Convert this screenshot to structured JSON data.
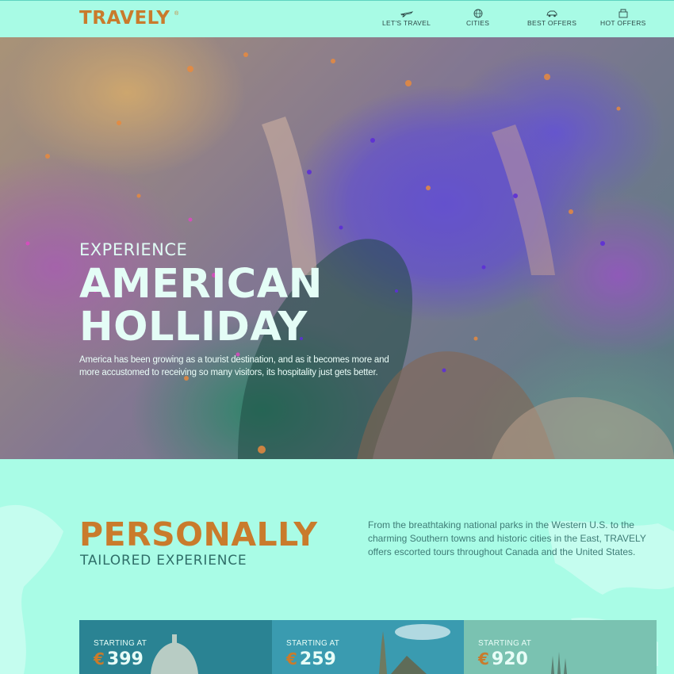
{
  "header": {
    "logo": "TRAVELY",
    "logo_mark": "®",
    "nav": [
      {
        "label": "LET'S TRAVEL",
        "icon": "plane-icon"
      },
      {
        "label": "CITIES",
        "icon": "globe-icon"
      },
      {
        "label": "BEST OFFERS",
        "icon": "car-icon"
      },
      {
        "label": "HOT OFFERS",
        "icon": "gift-icon"
      }
    ]
  },
  "hero": {
    "eyebrow": "EXPERIENCE",
    "title_line1": "AMERICAN",
    "title_line2": "HOLLIDAY",
    "text": "America has been growing as a tourist destination, and as it becomes more and more accustomed to receiving so many visitors, its hospitality just gets better."
  },
  "about": {
    "title": "PERSONALLY",
    "subtitle": "TAILORED EXPERIENCE",
    "text": "From the breathtaking national parks in the Western U.S. to the charming Southern towns and historic cities in the East, TRAVELY offers escorted tours throughout Canada and the United States."
  },
  "offers": [
    {
      "label": "STARTING AT",
      "currency": "€",
      "price": "399"
    },
    {
      "label": "STARTING AT",
      "currency": "€",
      "price": "259"
    },
    {
      "label": "STARTING AT",
      "currency": "€",
      "price": "920"
    }
  ],
  "colors": {
    "background": "#a9fce6",
    "accent": "#c97b2c",
    "heading_dark": "#2f6e68"
  }
}
